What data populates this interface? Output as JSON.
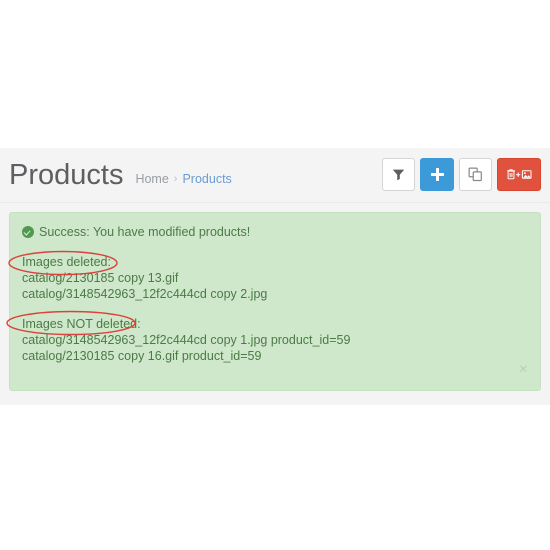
{
  "header": {
    "title": "Products",
    "breadcrumb": {
      "home": "Home",
      "separator": "›",
      "current": "Products"
    }
  },
  "toolbar": {
    "buttons": [
      {
        "name": "filter-button",
        "icon": "filter-icon",
        "label": ""
      },
      {
        "name": "add-button",
        "icon": "plus-icon",
        "label": ""
      },
      {
        "name": "duplicate-button",
        "icon": "copy-icon",
        "label": ""
      },
      {
        "name": "delete-images-button",
        "icon": "trash-plus-image-icon",
        "label": ""
      }
    ]
  },
  "alert": {
    "type": "success",
    "icon": "check-circle-icon",
    "message": "Success: You have modified products!",
    "deleted": {
      "label": "Images deleted:",
      "items": [
        "catalog/2130185 copy 13.gif",
        "catalog/3148542963_12f2c444cd copy 2.jpg"
      ]
    },
    "not_deleted": {
      "label": "Images NOT deleted:",
      "items": [
        "catalog/3148542963_12f2c444cd copy 1.jpg product_id=59",
        "catalog/2130185 copy 16.gif product_id=59"
      ]
    },
    "close_label": "×"
  },
  "colors": {
    "primary": "#3c9ad9",
    "danger": "#e0513e",
    "success_bg": "#cfe8cc",
    "success_text": "#4c7a47",
    "annotation": "#d9433b",
    "link": "#6a9cd4"
  }
}
